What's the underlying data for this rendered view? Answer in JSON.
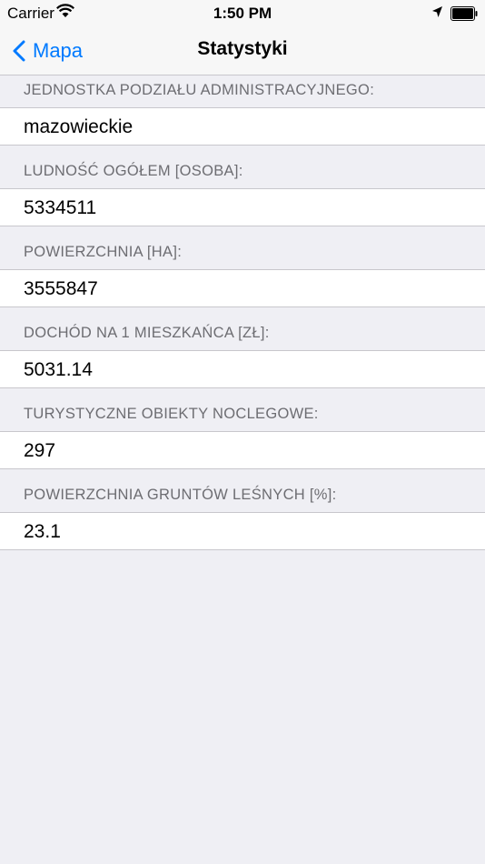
{
  "status_bar": {
    "carrier": "Carrier",
    "time": "1:50 PM"
  },
  "nav": {
    "back_label": "Mapa",
    "title": "Statystyki"
  },
  "rows": [
    {
      "header": "JEDNOSTKA PODZIAŁU ADMINISTRACYJNEGO:",
      "value": "mazowieckie"
    },
    {
      "header": "LUDNOŚĆ OGÓŁEM [OSOBA]:",
      "value": "5334511"
    },
    {
      "header": "POWIERZCHNIA [HA]:",
      "value": "3555847"
    },
    {
      "header": "DOCHÓD NA 1 MIESZKAŃCA [ZŁ]:",
      "value": "5031.14"
    },
    {
      "header": "TURYSTYCZNE OBIEKTY NOCLEGOWE:",
      "value": "297"
    },
    {
      "header": "POWIERZCHNIA GRUNTÓW LEŚNYCH [%]:",
      "value": "23.1"
    }
  ],
  "colors": {
    "accent": "#007aff",
    "background": "#efeff4",
    "header_text": "#6d6d72",
    "separator": "#c8c7cc"
  }
}
